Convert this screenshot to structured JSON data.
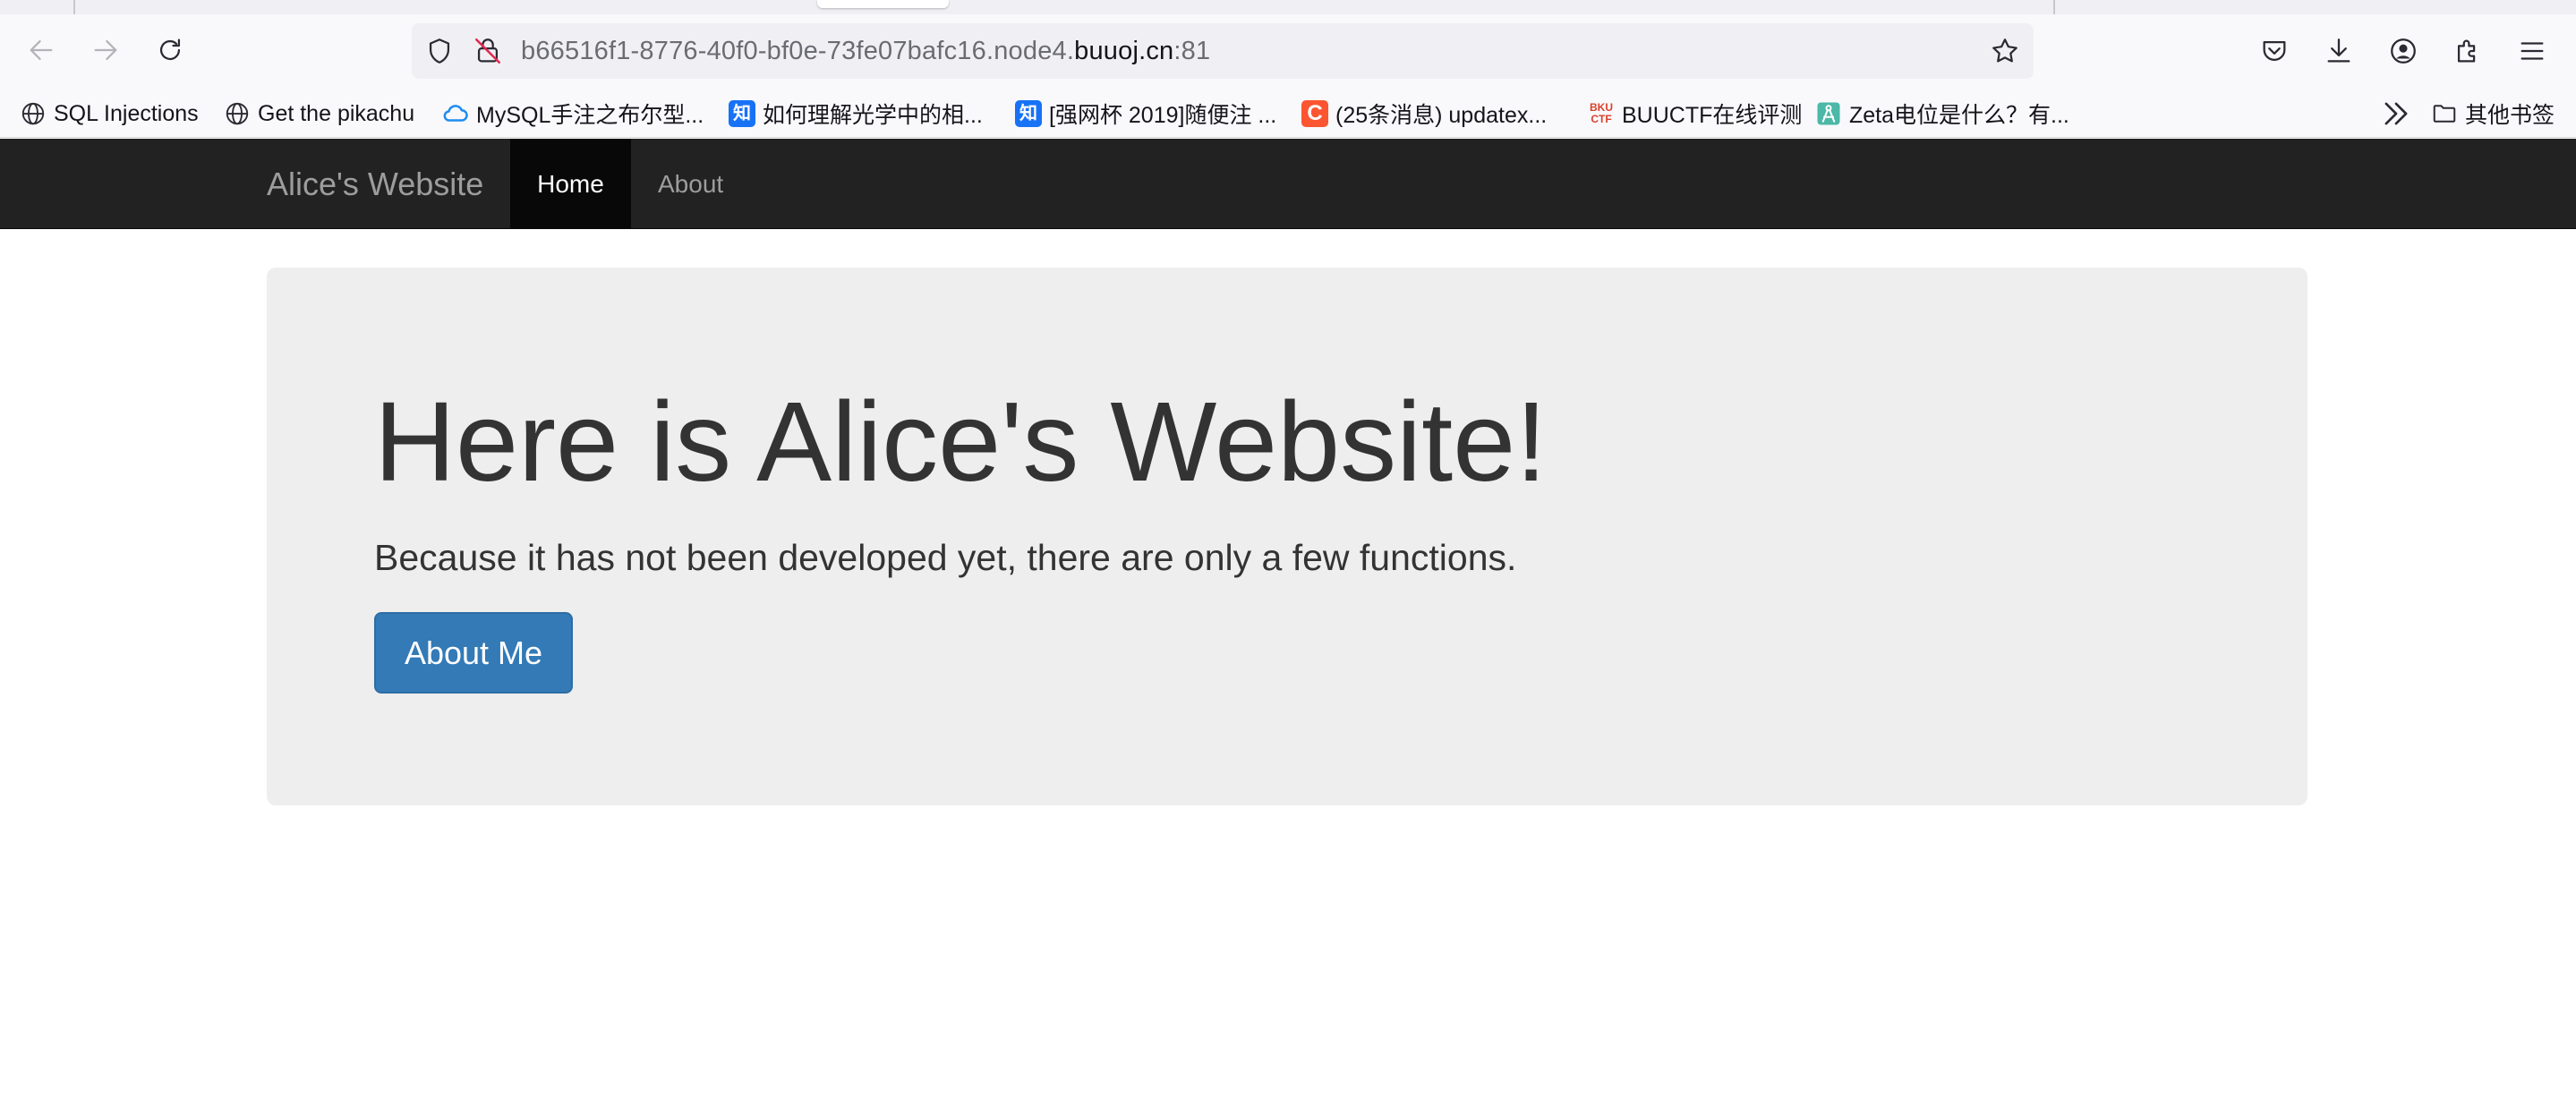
{
  "browser": {
    "url_prefix": "b66516f1-8776-40f0-bf0e-73fe07bafc16.node4.",
    "url_domain": "buuoj.cn",
    "url_suffix": ":81",
    "icons": {
      "back": "arrow-left-icon",
      "forward": "arrow-right-icon",
      "reload": "reload-icon",
      "shield": "shield-icon",
      "lock": "insecure-lock-icon",
      "star": "star-icon",
      "pocket": "pocket-icon",
      "downloads": "download-icon",
      "account": "account-icon",
      "extensions": "extensions-icon",
      "menu": "hamburger-menu-icon"
    }
  },
  "bookmarks": [
    {
      "label": "SQL Injections",
      "icon": "globe-icon"
    },
    {
      "label": "Get the pikachu",
      "icon": "globe-icon"
    },
    {
      "label": "MySQL手注之布尔型...",
      "icon": "cloud-icon"
    },
    {
      "label": "如何理解光学中的相...",
      "icon": "zhihu-icon"
    },
    {
      "label": "[强网杯 2019]随便注 ...",
      "icon": "zhihu-icon"
    },
    {
      "label": "(25条消息) updatex...",
      "icon": "csdn-icon"
    },
    {
      "label": "BUUCTF在线评测",
      "icon": "buuctf-icon"
    },
    {
      "label": "Zeta电位是什么？有...",
      "icon": "compass-icon"
    }
  ],
  "other_bookmarks": "其他书签",
  "site": {
    "brand": "Alice's Website",
    "nav": {
      "home": "Home",
      "about": "About"
    },
    "jumbotron": {
      "heading": "Here is Alice's Website!",
      "text": "Because it has not been developed yet, there are only a few functions.",
      "button": "About Me"
    },
    "colors": {
      "navbar_bg": "#222222",
      "active_nav_bg": "#080808",
      "jumbotron_bg": "#eeeeee",
      "primary_button": "#337ab7"
    }
  }
}
